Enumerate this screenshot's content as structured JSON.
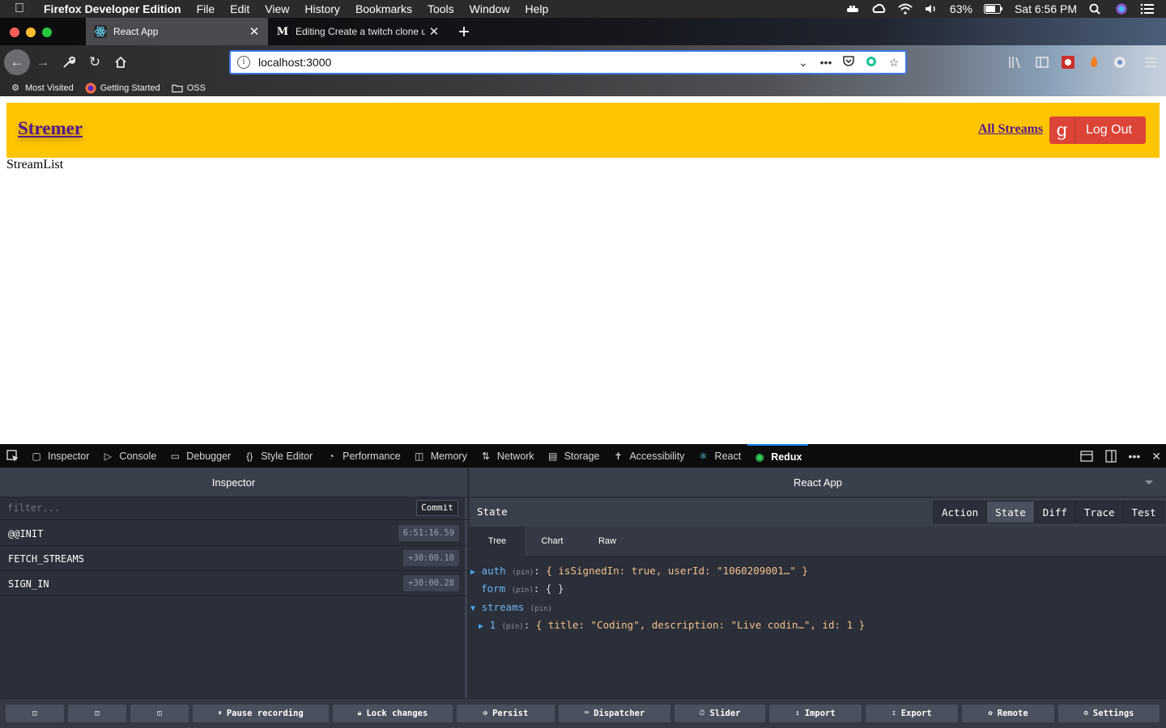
{
  "menubar": {
    "app_name": "Firefox Developer Edition",
    "menus": [
      "File",
      "Edit",
      "View",
      "History",
      "Bookmarks",
      "Tools",
      "Window",
      "Help"
    ],
    "battery": "63%",
    "clock": "Sat 6:56 PM"
  },
  "browser": {
    "tabs": [
      {
        "title": "React App",
        "icon": "react-icon"
      },
      {
        "title": "Editing Create a twitch clone usi",
        "icon": "medium-icon"
      }
    ],
    "new_tab_label": "+",
    "url": "localhost:3000",
    "bookmarks": [
      {
        "label": "Most Visited",
        "icon": "gear-icon"
      },
      {
        "label": "Getting Started",
        "icon": "firefox-icon"
      },
      {
        "label": "OSS",
        "icon": "folder-icon"
      }
    ]
  },
  "page": {
    "brand": "Stremer",
    "nav_link": "All Streams",
    "logout_label": "Log Out",
    "logout_icon": "google-icon",
    "body_text": "StreamList"
  },
  "devtools": {
    "tabs": [
      {
        "label": "Inspector",
        "icon": "inspector-icon"
      },
      {
        "label": "Console",
        "icon": "console-icon"
      },
      {
        "label": "Debugger",
        "icon": "debugger-icon"
      },
      {
        "label": "Style Editor",
        "icon": "braces-icon"
      },
      {
        "label": "Performance",
        "icon": "gauge-icon"
      },
      {
        "label": "Memory",
        "icon": "memory-icon"
      },
      {
        "label": "Network",
        "icon": "network-icon"
      },
      {
        "label": "Storage",
        "icon": "storage-icon"
      },
      {
        "label": "Accessibility",
        "icon": "accessibility-icon"
      },
      {
        "label": "React",
        "icon": "react-icon"
      },
      {
        "label": "Redux",
        "icon": "redux-icon",
        "active": true
      }
    ],
    "accent": "#0a84ff"
  },
  "redux": {
    "monitor_select": "Inspector",
    "instance_select": "React App",
    "filter_placeholder": "filter...",
    "commit_label": "Commit",
    "actions": [
      {
        "name": "@@INIT",
        "time": "6:51:16.59"
      },
      {
        "name": "FETCH_STREAMS",
        "time": "+30:00.10"
      },
      {
        "name": "SIGN_IN",
        "time": "+30:00.28"
      }
    ],
    "panel_title": "State",
    "mode_tabs": [
      "Action",
      "State",
      "Diff",
      "Trace",
      "Test"
    ],
    "active_mode": "State",
    "view_tabs": [
      "Tree",
      "Chart",
      "Raw"
    ],
    "active_view": "Tree",
    "tree": {
      "auth_key": "auth",
      "auth_value": "{ isSignedIn: true, userId: \"1060209001…\" }",
      "form_key": "form",
      "form_value": "{ }",
      "streams_key": "streams",
      "item_key": "1",
      "item_value": "{ title: \"Coding\", description: \"Live codin…\", id: 1 }",
      "pin": "(pin)",
      "colon": ":"
    },
    "bottom_buttons": [
      {
        "label": "",
        "icon": "dock-left-icon"
      },
      {
        "label": "",
        "icon": "dock-bottom-icon"
      },
      {
        "label": "",
        "icon": "dock-right-icon"
      },
      {
        "label": "Pause recording",
        "icon": "pause-icon"
      },
      {
        "label": "Lock changes",
        "icon": "lock-icon"
      },
      {
        "label": "Persist",
        "icon": "pin-icon"
      },
      {
        "label": "Dispatcher",
        "icon": "keyboard-icon"
      },
      {
        "label": "Slider",
        "icon": "clock-icon"
      },
      {
        "label": "Import",
        "icon": "upload-icon"
      },
      {
        "label": "Export",
        "icon": "download-icon"
      },
      {
        "label": "Remote",
        "icon": "broadcast-icon"
      },
      {
        "label": "Settings",
        "icon": "gear-icon"
      }
    ]
  }
}
